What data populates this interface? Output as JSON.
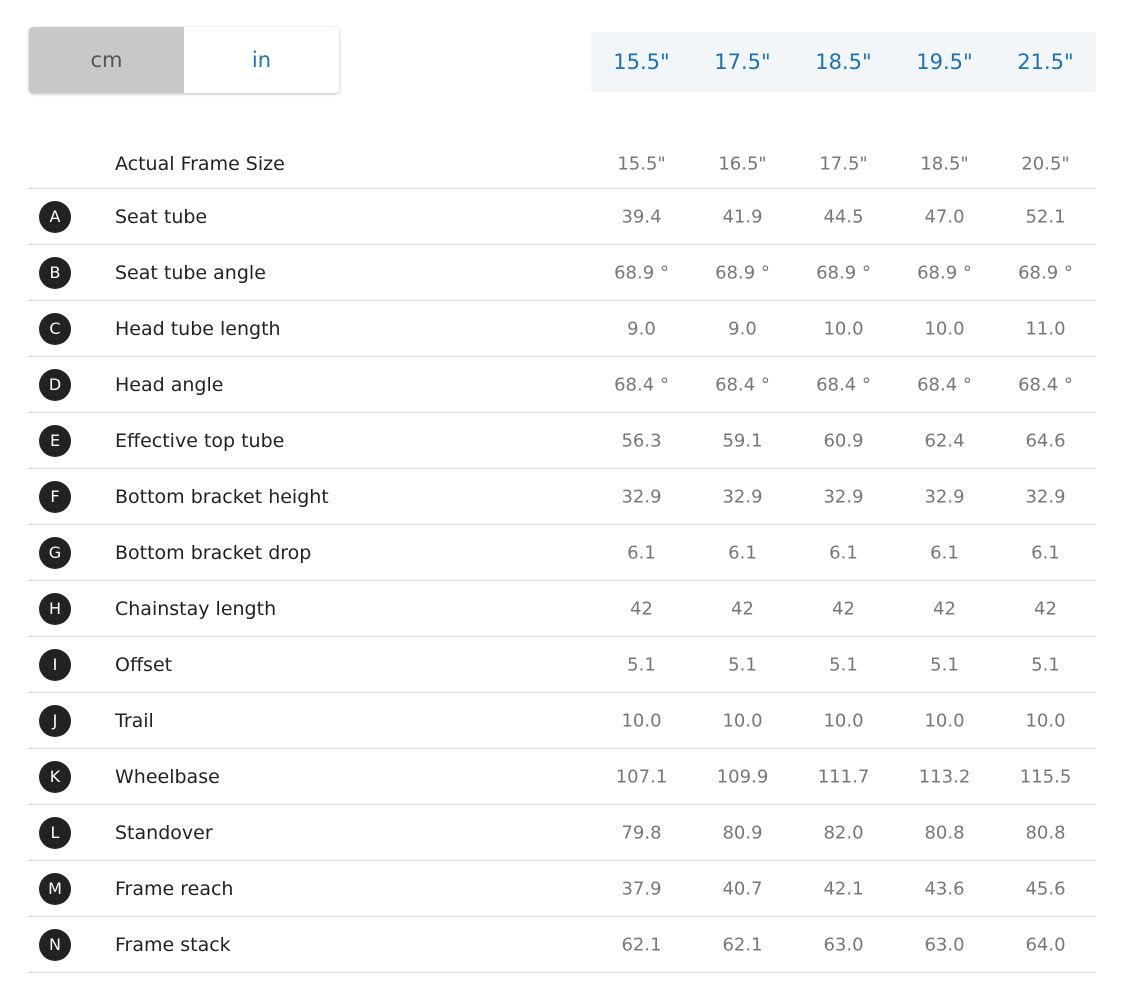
{
  "units": {
    "cm_label": "cm",
    "in_label": "in",
    "selected": "cm"
  },
  "sizes": [
    "15.5\"",
    "17.5\"",
    "18.5\"",
    "19.5\"",
    "21.5\""
  ],
  "colors": {
    "accent": "#1a73b8",
    "toggle_active_bg": "#c8c8c8",
    "header_bg": "#f3f6f8",
    "badge_bg": "#222222"
  },
  "table": {
    "header": {
      "label": "Actual Frame Size",
      "values": [
        "15.5\"",
        "16.5\"",
        "17.5\"",
        "18.5\"",
        "20.5\""
      ]
    },
    "rows": [
      {
        "letter": "A",
        "label": "Seat tube",
        "values": [
          "39.4",
          "41.9",
          "44.5",
          "47.0",
          "52.1"
        ]
      },
      {
        "letter": "B",
        "label": "Seat tube angle",
        "values": [
          "68.9 °",
          "68.9 °",
          "68.9 °",
          "68.9 °",
          "68.9 °"
        ]
      },
      {
        "letter": "C",
        "label": "Head tube length",
        "values": [
          "9.0",
          "9.0",
          "10.0",
          "10.0",
          "11.0"
        ]
      },
      {
        "letter": "D",
        "label": "Head angle",
        "values": [
          "68.4 °",
          "68.4 °",
          "68.4 °",
          "68.4 °",
          "68.4 °"
        ]
      },
      {
        "letter": "E",
        "label": "Effective top tube",
        "values": [
          "56.3",
          "59.1",
          "60.9",
          "62.4",
          "64.6"
        ]
      },
      {
        "letter": "F",
        "label": "Bottom bracket height",
        "values": [
          "32.9",
          "32.9",
          "32.9",
          "32.9",
          "32.9"
        ]
      },
      {
        "letter": "G",
        "label": "Bottom bracket drop",
        "values": [
          "6.1",
          "6.1",
          "6.1",
          "6.1",
          "6.1"
        ]
      },
      {
        "letter": "H",
        "label": "Chainstay length",
        "values": [
          "42",
          "42",
          "42",
          "42",
          "42"
        ]
      },
      {
        "letter": "I",
        "label": "Offset",
        "values": [
          "5.1",
          "5.1",
          "5.1",
          "5.1",
          "5.1"
        ]
      },
      {
        "letter": "J",
        "label": "Trail",
        "values": [
          "10.0",
          "10.0",
          "10.0",
          "10.0",
          "10.0"
        ]
      },
      {
        "letter": "K",
        "label": "Wheelbase",
        "values": [
          "107.1",
          "109.9",
          "111.7",
          "113.2",
          "115.5"
        ]
      },
      {
        "letter": "L",
        "label": "Standover",
        "values": [
          "79.8",
          "80.9",
          "82.0",
          "80.8",
          "80.8"
        ]
      },
      {
        "letter": "M",
        "label": "Frame reach",
        "values": [
          "37.9",
          "40.7",
          "42.1",
          "43.6",
          "45.6"
        ]
      },
      {
        "letter": "N",
        "label": "Frame stack",
        "values": [
          "62.1",
          "62.1",
          "63.0",
          "63.0",
          "64.0"
        ]
      }
    ]
  }
}
